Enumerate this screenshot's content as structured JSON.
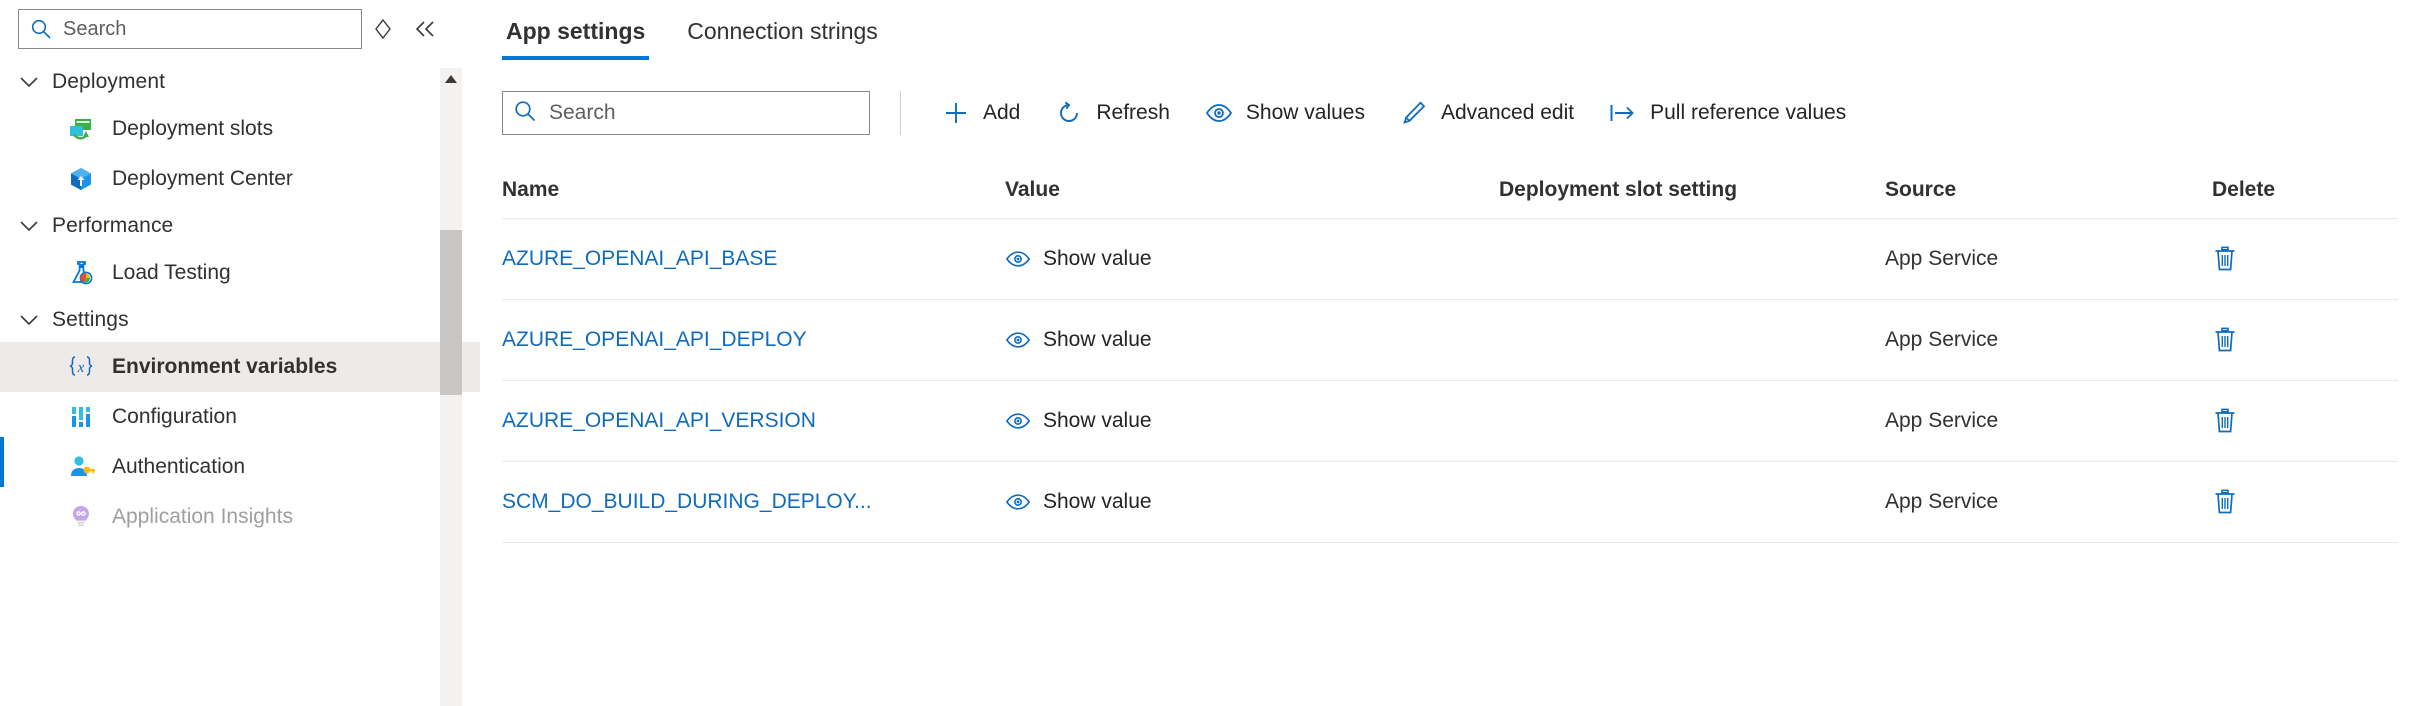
{
  "sidebar": {
    "search": {
      "value": "",
      "placeholder": "Search",
      "icon": "search-icon"
    },
    "sort_icon": "sort-diamond-icon",
    "collapse_icon": "double-chevron-left-icon",
    "groups": [
      {
        "label": "Deployment",
        "expanded": true,
        "items": [
          {
            "label": "Deployment slots",
            "icon": "deployment-slots-icon",
            "selected": false,
            "disabled": false
          },
          {
            "label": "Deployment Center",
            "icon": "deployment-center-icon",
            "selected": false,
            "disabled": false
          }
        ]
      },
      {
        "label": "Performance",
        "expanded": true,
        "items": [
          {
            "label": "Load Testing",
            "icon": "load-testing-flask-icon",
            "selected": false,
            "disabled": false
          }
        ]
      },
      {
        "label": "Settings",
        "expanded": true,
        "items": [
          {
            "label": "Environment variables",
            "icon": "curly-braces-x-icon",
            "selected": true,
            "disabled": false
          },
          {
            "label": "Configuration",
            "icon": "configuration-sliders-icon",
            "selected": false,
            "disabled": false
          },
          {
            "label": "Authentication",
            "icon": "authentication-user-key-icon",
            "selected": false,
            "disabled": false
          },
          {
            "label": "Application Insights",
            "icon": "application-insights-bulb-icon",
            "selected": false,
            "disabled": true
          }
        ]
      }
    ]
  },
  "main": {
    "tabs": [
      {
        "label": "App settings",
        "active": true
      },
      {
        "label": "Connection strings",
        "active": false
      }
    ],
    "toolbar": {
      "search": {
        "value": "",
        "placeholder": "Search",
        "icon": "search-icon"
      },
      "buttons": [
        {
          "label": "Add",
          "icon": "plus-icon"
        },
        {
          "label": "Refresh",
          "icon": "refresh-icon"
        },
        {
          "label": "Show values",
          "icon": "eye-icon"
        },
        {
          "label": "Advanced edit",
          "icon": "pencil-icon"
        },
        {
          "label": "Pull reference values",
          "icon": "pull-arrow-icon"
        }
      ]
    },
    "table": {
      "columns": [
        "Name",
        "Value",
        "Deployment slot setting",
        "Source",
        "Delete"
      ],
      "show_value_label": "Show value",
      "delete_icon": "trash-icon",
      "rows": [
        {
          "name": "AZURE_OPENAI_API_BASE",
          "value": "Show value",
          "slot_setting": "",
          "source": "App Service"
        },
        {
          "name": "AZURE_OPENAI_API_DEPLOY",
          "value": "Show value",
          "slot_setting": "",
          "source": "App Service"
        },
        {
          "name": "AZURE_OPENAI_API_VERSION",
          "value": "Show value",
          "slot_setting": "",
          "source": "App Service"
        },
        {
          "name": "SCM_DO_BUILD_DURING_DEPLOY...",
          "value": "Show value",
          "slot_setting": "",
          "source": "App Service"
        }
      ]
    }
  },
  "colors": {
    "accent": "#0078d4",
    "link": "#0f6cbd",
    "selected_row_bg": "#edebe9",
    "text": "#323130",
    "disabled_text": "#a19f9d"
  }
}
